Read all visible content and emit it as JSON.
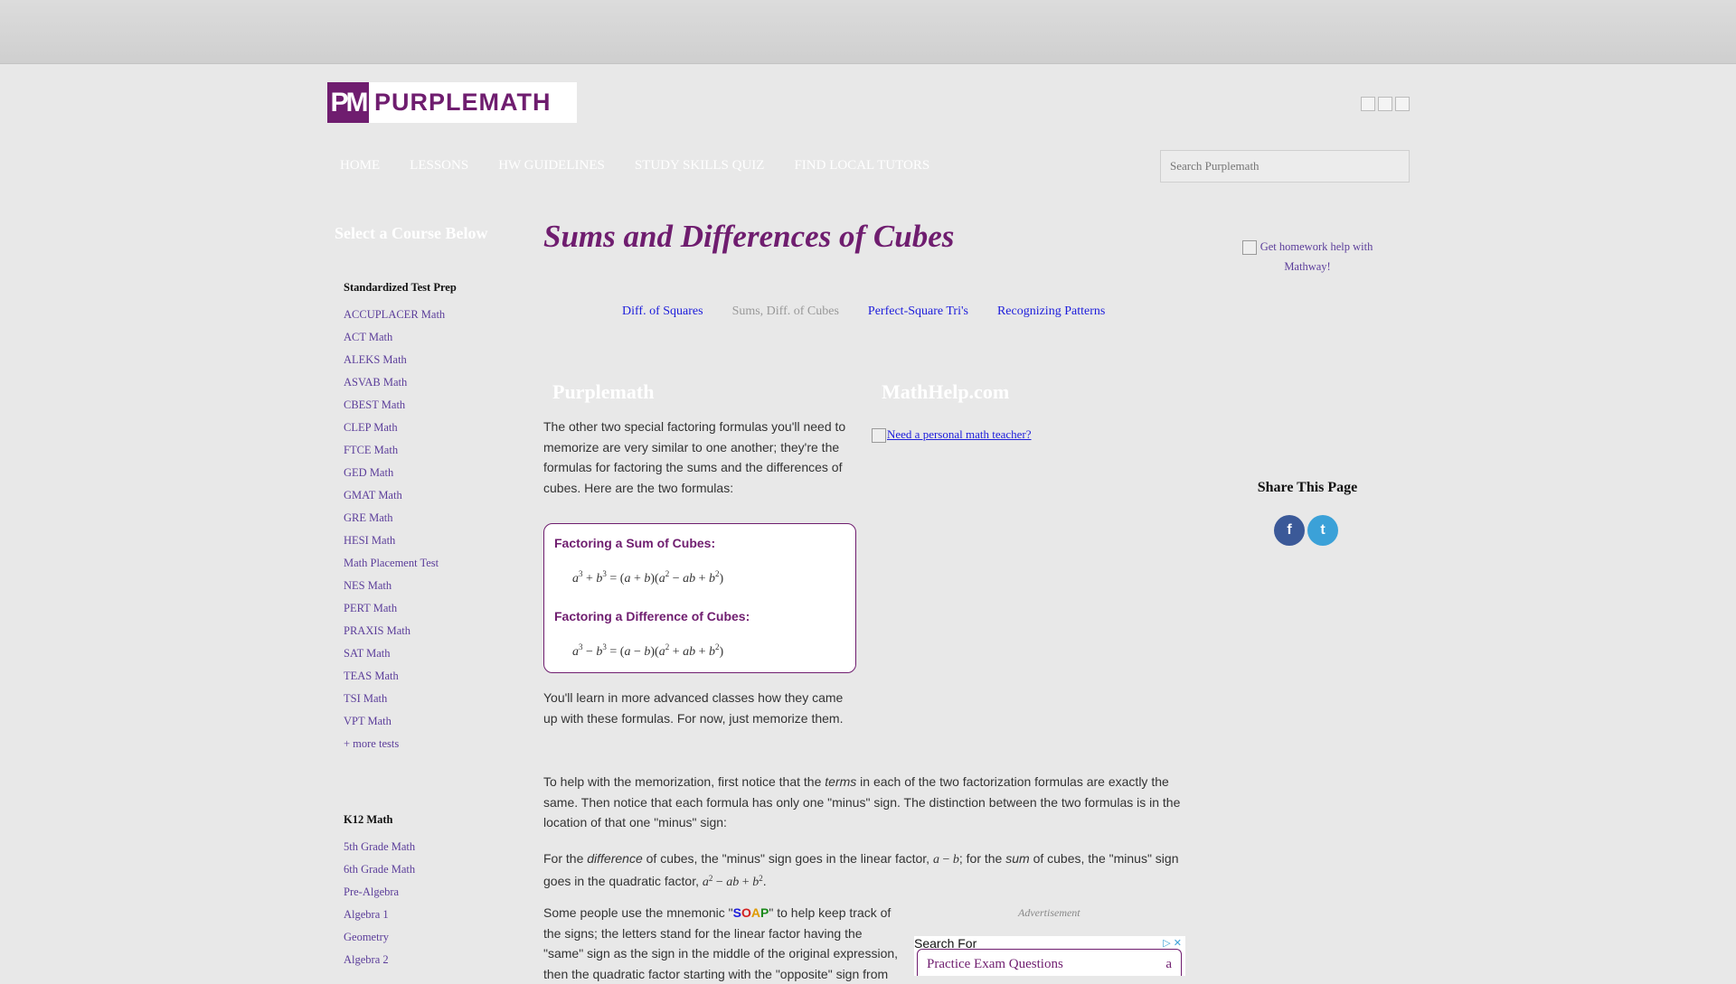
{
  "header": {
    "logo_mark": "PM",
    "logo_text": "PURPLEMATH",
    "flags": [
      "flag-1",
      "flag-2",
      "flag-3"
    ]
  },
  "nav": {
    "items": [
      "HOME",
      "LESSONS",
      "HW GUIDELINES",
      "STUDY SKILLS QUIZ",
      "FIND LOCAL TUTORS"
    ]
  },
  "search": {
    "placeholder": "Search Purplemath"
  },
  "sidebar": {
    "heading": "Select a Course Below",
    "test_prep": {
      "title": "Standardized Test Prep",
      "items": [
        "ACCUPLACER Math",
        "ACT Math",
        "ALEKS Math",
        "ASVAB Math",
        "CBEST Math",
        "CLEP Math",
        "FTCE Math",
        "GED Math",
        "GMAT Math",
        "GRE Math",
        "HESI Math",
        "Math Placement Test",
        "NES Math",
        "PERT Math",
        "PRAXIS Math",
        "SAT Math",
        "TEAS Math",
        "TSI Math",
        "VPT Math",
        "+ more tests"
      ]
    },
    "k12": {
      "title": "K12 Math",
      "items": [
        "5th Grade Math",
        "6th Grade Math",
        "Pre-Algebra",
        "Algebra 1",
        "Geometry",
        "Algebra 2"
      ]
    }
  },
  "main": {
    "title": "Sums and Differences of Cubes",
    "tabs": {
      "diff_squares": "Diff. of Squares",
      "cubes": "Sums, Diff. of Cubes",
      "perfect_square": "Perfect-Square Tri's",
      "patterns": "Recognizing Patterns"
    },
    "col_left": "Purplemath",
    "col_right": "MathHelp.com",
    "mathhelp_link": "Need a personal math teacher?",
    "intro": "The other two special factoring formulas you'll need to memorize are very similar to one another; they're the formulas for factoring the sums and the differences of cubes. Here are the two formulas:",
    "sum_label": "Factoring a Sum of Cubes:",
    "diff_label": "Factoring a Difference of Cubes:",
    "after_box": "You'll learn in more advanced classes how they came up with these formulas. For now, just memorize them.",
    "para2_a": "To help with the memorization, first notice that the ",
    "para2_terms": "terms",
    "para2_b": " in each of the two factorization formulas are exactly the same. Then notice that each formula has only one \"minus\" sign. The distinction between the two formulas is in the location of that one \"minus\" sign:",
    "para3_a": "For the ",
    "para3_difference": "difference",
    "para3_b": " of cubes, the \"minus\" sign goes in the linear factor, ",
    "para3_c": "; for the ",
    "para3_sum": "sum",
    "para3_d": " of cubes, the \"minus\" sign goes in the quadratic factor, ",
    "para4_a": "Some people use the mnemonic \"",
    "para4_b": "\" to help keep track of the signs; the letters stand for the linear factor having the \"same\" sign as the sign in the middle of the original expression, then the quadratic factor starting with the \"opposite\" sign from",
    "soap": [
      "S",
      "O",
      "A",
      "P"
    ]
  },
  "right": {
    "ad_alt": "Get homework help with Mathway!",
    "share_title": "Share This Page",
    "facebook": "f",
    "twitter": "t"
  },
  "ad": {
    "label": "Advertisement",
    "search_for": "Search For",
    "result": "Practice Exam Questions",
    "arrow": "a"
  },
  "colors": {
    "brand_purple": "#6f1d6f",
    "link_blue": "#1d1ddb",
    "side_link": "#5b3d9a",
    "facebook": "#3b5998",
    "twitter": "#3ba1d8"
  }
}
